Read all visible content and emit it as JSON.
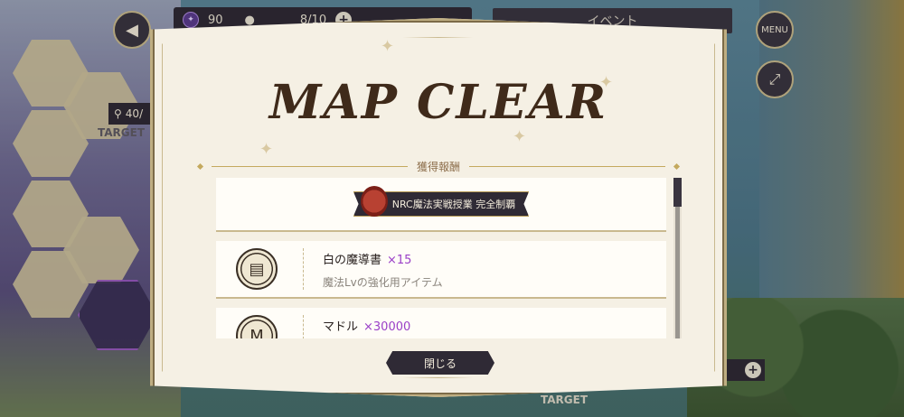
{
  "hud": {
    "gem_count": "90",
    "stamina": "8/10",
    "event_tab": "イベント",
    "menu_label": "MENU",
    "counter": "40/",
    "target_label_left": "TARGET",
    "target_label_bottom": "TARGET"
  },
  "modal": {
    "title": "MAP CLEAR",
    "section_label": "獲得報酬",
    "banner_text": "NRC魔法実戦授業 完全制覇",
    "items": [
      {
        "name": "白の魔導書",
        "qty": "×15",
        "desc": "魔法Lvの強化用アイテム",
        "icon": "book-icon"
      },
      {
        "name": "マドル",
        "qty": "×30000",
        "desc": "",
        "icon": "coin-icon"
      }
    ],
    "close_label": "閉じる"
  },
  "colors": {
    "accent_purple": "#9a3fc7",
    "panel_dark": "#2f2a35",
    "gold": "#c4a95e"
  }
}
